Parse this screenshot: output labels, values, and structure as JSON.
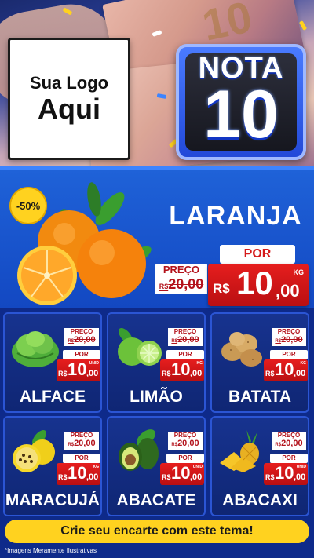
{
  "header": {
    "logo": {
      "line1": "Sua Logo",
      "line2": "Aqui"
    },
    "badge": {
      "word": "NOTA",
      "number": "10"
    }
  },
  "featured": {
    "discount": "-50%",
    "name": "LARANJA",
    "preco_label": "PREÇO",
    "old_prefix": "R$",
    "old_price": "20,00",
    "por_label": "POR",
    "currency": "R$",
    "price_int": "10",
    "price_dec": ",00",
    "unit": "KG"
  },
  "products": [
    {
      "name": "ALFACE",
      "preco_label": "PREÇO",
      "old_prefix": "R$",
      "old_price": "20,00",
      "por_label": "POR",
      "currency": "R$",
      "price_int": "10",
      "price_dec": ",00",
      "unit": "UNID",
      "icon": "lettuce-icon"
    },
    {
      "name": "LIMÃO",
      "preco_label": "PREÇO",
      "old_prefix": "R$",
      "old_price": "20,00",
      "por_label": "POR",
      "currency": "R$",
      "price_int": "10",
      "price_dec": ",00",
      "unit": "KG",
      "icon": "lime-icon"
    },
    {
      "name": "BATATA",
      "preco_label": "PREÇO",
      "old_prefix": "R$",
      "old_price": "20,00",
      "por_label": "POR",
      "currency": "R$",
      "price_int": "10",
      "price_dec": ",00",
      "unit": "KG",
      "icon": "potato-icon"
    },
    {
      "name": "MARACUJÁ",
      "preco_label": "PREÇO",
      "old_prefix": "R$",
      "old_price": "20,00",
      "por_label": "POR",
      "currency": "R$",
      "price_int": "10",
      "price_dec": ",00",
      "unit": "KG",
      "icon": "passion-fruit-icon"
    },
    {
      "name": "ABACATE",
      "preco_label": "PREÇO",
      "old_prefix": "R$",
      "old_price": "20,00",
      "por_label": "POR",
      "currency": "R$",
      "price_int": "10",
      "price_dec": ",00",
      "unit": "UNID",
      "icon": "avocado-icon"
    },
    {
      "name": "ABACAXI",
      "preco_label": "PREÇO",
      "old_prefix": "R$",
      "old_price": "20,00",
      "por_label": "POR",
      "currency": "R$",
      "price_int": "10",
      "price_dec": ",00",
      "unit": "UNID",
      "icon": "pineapple-icon"
    }
  ],
  "cta": "Crie seu encarte com este tema!",
  "disclaimer": "*Imagens Meramente Ilustrativas",
  "colors": {
    "blue": "#1348c2",
    "navy": "#0e2a8a",
    "red": "#d51a1a",
    "yellow": "#ffd21f"
  }
}
